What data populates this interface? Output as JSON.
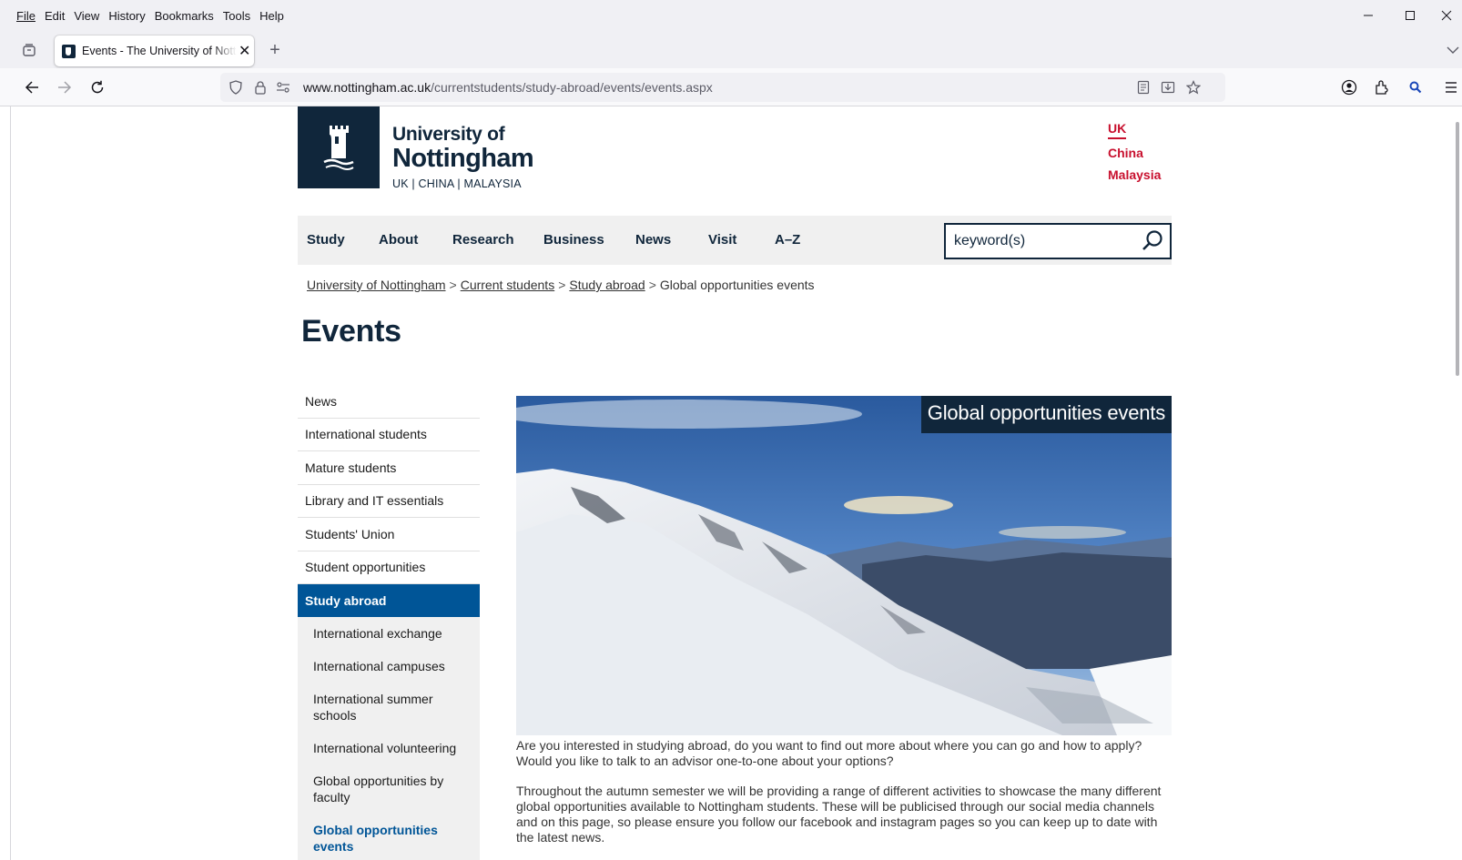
{
  "browser": {
    "menu": [
      "File",
      "Edit",
      "View",
      "History",
      "Bookmarks",
      "Tools",
      "Help"
    ],
    "tab_title": "Events - The University of Nottingham",
    "url_host": "www.nottingham.ac.uk",
    "url_path": "/currentstudents/study-abroad/events/events.aspx"
  },
  "header": {
    "brand_line1": "University of",
    "brand_line2": "Nottingham",
    "brand_line3": "UK | CHINA | MALAYSIA",
    "campuses": [
      "UK",
      "China",
      "Malaysia"
    ]
  },
  "mainnav": {
    "items": [
      "Study",
      "About",
      "Research",
      "Business",
      "News",
      "Visit",
      "A–Z"
    ],
    "search_value": "keyword(s)"
  },
  "breadcrumb": {
    "items": [
      "University of Nottingham",
      "Current students",
      "Study abroad"
    ],
    "current": "Global opportunities events"
  },
  "page_title": "Events",
  "sidenav": {
    "items": [
      "News",
      "International students",
      "Mature students",
      "Library and IT essentials",
      "Students' Union",
      "Student opportunities"
    ],
    "active": "Study abroad",
    "subitems": [
      "International exchange",
      "International campuses",
      "International summer schools",
      "International volunteering",
      "Global opportunities by faculty"
    ],
    "current_sub": "Global opportunities events"
  },
  "hero": {
    "caption": "Global opportunities events"
  },
  "content": {
    "para1": "Are you interested in studying abroad, do you want to find out more about where you can go and how to apply? Would you like to talk to an advisor one-to-one about your options?",
    "para2": "Throughout the autumn semester we will be providing a range of different activities to showcase the many different global opportunities available to Nottingham students. These will be publicised through our social media channels and on this page, so please ensure you follow our facebook and instagram pages so you can keep up to date with the latest news."
  },
  "colors": {
    "brand_navy": "#10263b",
    "campus_red": "#c8102e",
    "active_blue": "#005597"
  }
}
